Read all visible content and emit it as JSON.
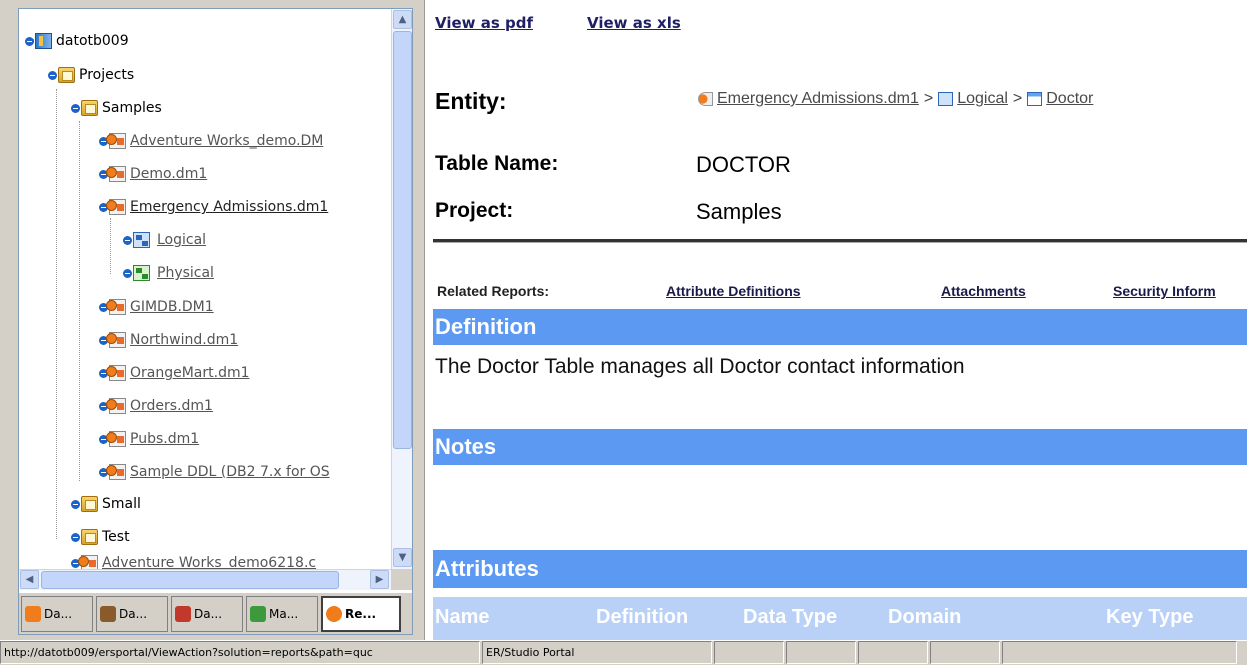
{
  "tree": {
    "root": "datotb009",
    "projects": "Projects",
    "samples": "Samples",
    "models": [
      "Adventure Works_demo.DM",
      "Demo.dm1",
      "Emergency Admissions.dm1"
    ],
    "logical": "Logical",
    "physical": "Physical",
    "models2": [
      "GIMDB.DM1",
      "Northwind.dm1",
      "OrangeMart.dm1",
      "Orders.dm1",
      "Pubs.dm1",
      "Sample DDL (DB2 7.x for OS"
    ],
    "small": "Small",
    "test": "Test",
    "last": "Adventure Works_demo6218.c"
  },
  "tabs": [
    {
      "label": "Da...",
      "color": "#f07c1c"
    },
    {
      "label": "Da...",
      "color": "#8b5a2b"
    },
    {
      "label": "Da...",
      "color": "#c0392b"
    },
    {
      "label": "Ma...",
      "color": "#3c9a3c"
    },
    {
      "label": "Re...",
      "color": "#f07c1c"
    }
  ],
  "content": {
    "view_pdf": "View as pdf",
    "view_xls": "View as xls",
    "entity_label": "Entity:",
    "breadcrumb": {
      "model": "Emergency Admissions.dm1",
      "sep": ">",
      "logical": "Logical",
      "entity": "Doctor"
    },
    "table_name_label": "Table Name:",
    "table_name_value": "DOCTOR",
    "project_label": "Project:",
    "project_value": "Samples",
    "related_label": "Related Reports:",
    "related_links": [
      "Attribute Definitions",
      "Attachments",
      "Security Inform"
    ],
    "definition_header": "Definition",
    "definition_text": "The Doctor Table manages all Doctor contact information",
    "notes_header": "Notes",
    "attributes_header": "Attributes",
    "columns": [
      "Name",
      "Definition",
      "Data Type",
      "Domain",
      "Key Type"
    ]
  },
  "status": {
    "url": "http://datotb009/ersportal/ViewAction?solution=reports&path=quc",
    "app": "ER/Studio Portal"
  },
  "colors": {
    "section_blue": "#5b99f2",
    "header_light_blue": "#b9d1f7"
  }
}
